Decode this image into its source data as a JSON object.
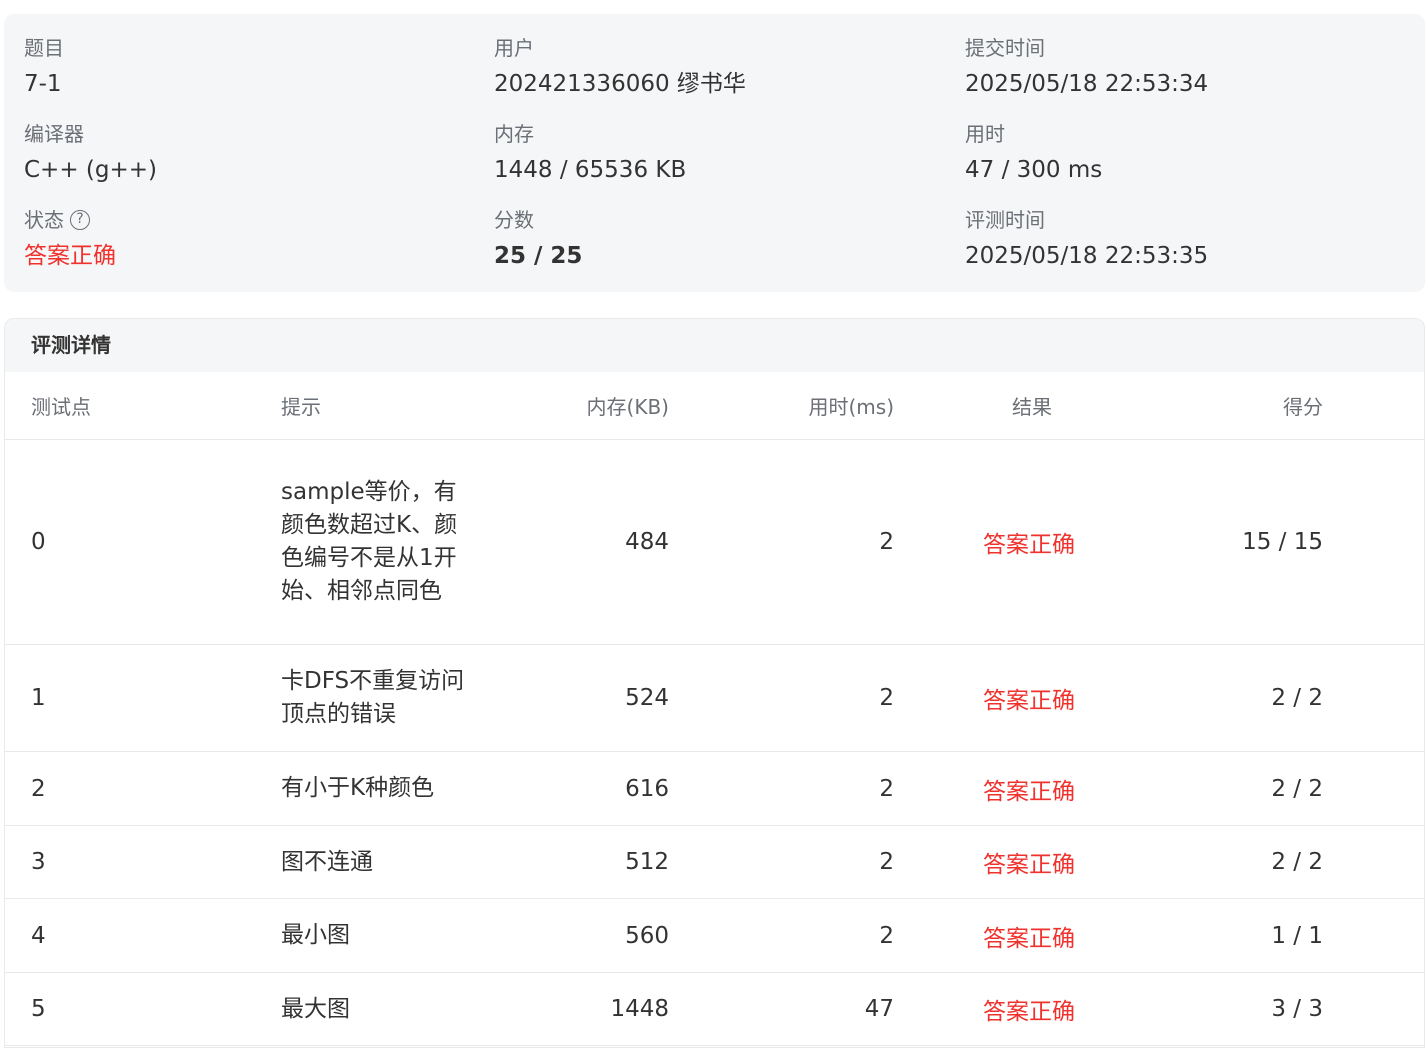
{
  "summary": {
    "problem": {
      "label": "题目",
      "value": "7-1"
    },
    "user": {
      "label": "用户",
      "value": "202421336060 缪书华"
    },
    "submit_time": {
      "label": "提交时间",
      "value": "2025/05/18 22:53:34"
    },
    "compiler": {
      "label": "编译器",
      "value": "C++ (g++)"
    },
    "memory": {
      "label": "内存",
      "value": "1448 / 65536 KB"
    },
    "time_used": {
      "label": "用时",
      "value": "47 / 300 ms"
    },
    "status": {
      "label": "状态",
      "value": "答案正确",
      "help_icon": "?"
    },
    "score": {
      "label": "分数",
      "value": "25 / 25"
    },
    "judge_time": {
      "label": "评测时间",
      "value": "2025/05/18 22:53:35"
    }
  },
  "detail": {
    "title": "评测详情",
    "columns": {
      "id": "测试点",
      "hint": "提示",
      "memory": "内存(KB)",
      "time": "用时(ms)",
      "result": "结果",
      "score": "得分"
    },
    "rows": [
      {
        "id": "0",
        "hint": "sample等价，有颜色数超过K、颜色编号不是从1开始、相邻点同色",
        "memory": "484",
        "time": "2",
        "result": "答案正确",
        "score": "15 / 15"
      },
      {
        "id": "1",
        "hint": "卡DFS不重复访问顶点的错误",
        "memory": "524",
        "time": "2",
        "result": "答案正确",
        "score": "2 / 2"
      },
      {
        "id": "2",
        "hint": "有小于K种颜色",
        "memory": "616",
        "time": "2",
        "result": "答案正确",
        "score": "2 / 2"
      },
      {
        "id": "3",
        "hint": "图不连通",
        "memory": "512",
        "time": "2",
        "result": "答案正确",
        "score": "2 / 2"
      },
      {
        "id": "4",
        "hint": "最小图",
        "memory": "560",
        "time": "2",
        "result": "答案正确",
        "score": "1 / 1"
      },
      {
        "id": "5",
        "hint": "最大图",
        "memory": "1448",
        "time": "47",
        "result": "答案正确",
        "score": "3 / 3"
      }
    ]
  },
  "colors": {
    "accepted": "#f0322d",
    "panel_bg": "#f5f6f7",
    "label": "#6b6f76"
  }
}
